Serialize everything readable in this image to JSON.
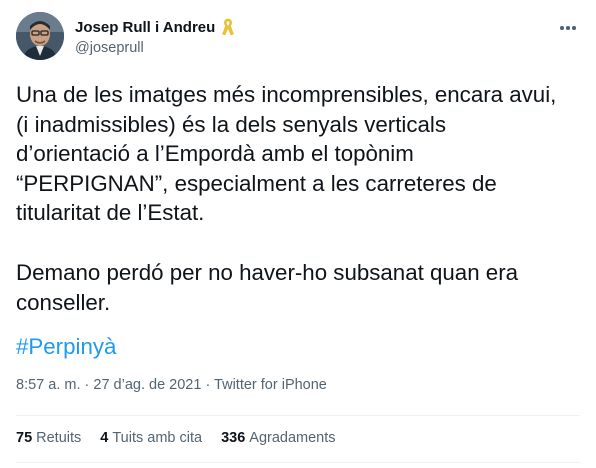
{
  "author": {
    "display_name": "Josep Rull i Andreu",
    "handle": "@joseprull",
    "ribbon_icon": "yellow-ribbon-icon",
    "ribbon_color": "#f2c12e"
  },
  "more_icon": "more-horizontal-icon",
  "tweet": {
    "paragraph_1": "Una de les imatges més incomprensibles, encara avui,\n(i inadmissibles) és la dels senyals verticals\nd’orientació a l’Empordà amb el topònim\n“PERPIGNAN”, especialment a les carreteres de\ntitularitat de l’Estat.",
    "paragraph_2": "Demano perdó per no haver-ho subsanat quan era\nconseller.",
    "hashtag": "#Perpinyà",
    "hashtag_color": "#1d9bf0"
  },
  "meta": {
    "time": "8:57 a. m.",
    "separator_1": " · ",
    "date": "27 d’ag. de 2021",
    "separator_2": " · ",
    "source": "Twitter for iPhone"
  },
  "stats": {
    "retweets_count": "75",
    "retweets_label": "Retuits",
    "quotes_count": "4",
    "quotes_label": "Tuits amb cita",
    "likes_count": "336",
    "likes_label": "Agradaments"
  }
}
